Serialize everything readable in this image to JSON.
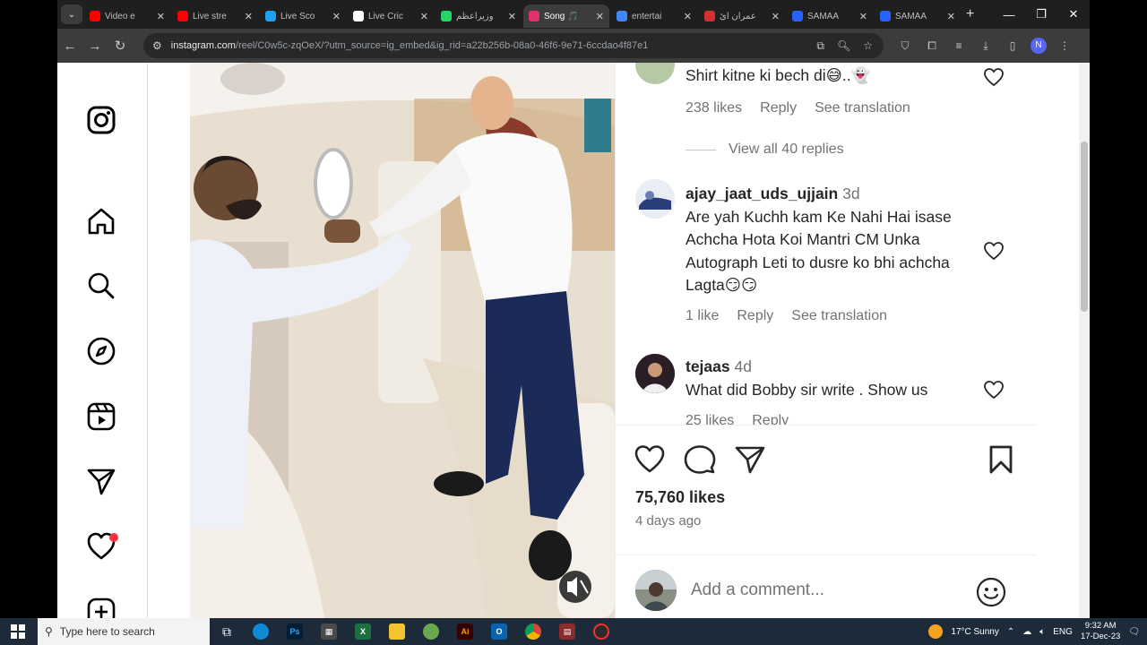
{
  "browser": {
    "tabs": [
      {
        "title": "Video e",
        "color": "#ff0000"
      },
      {
        "title": "Live stre",
        "color": "#ff0000"
      },
      {
        "title": "Live Sco",
        "color": "#1da1f2"
      },
      {
        "title": "Live Cric",
        "color": "#ffffff"
      },
      {
        "title": "وزیراعظم",
        "color": "#25d366"
      },
      {
        "title": "Song 🎵",
        "color": "#e1306c",
        "active": true
      },
      {
        "title": "entertai",
        "color": "#4285f4"
      },
      {
        "title": "عمران آئ",
        "color": "#d32f2f"
      },
      {
        "title": "SAMAA",
        "color": "#2962ff"
      },
      {
        "title": "SAMAA",
        "color": "#2962ff"
      }
    ],
    "url_host": "instagram.com",
    "url_rest": "/reel/C0w5c-zqOeX/?utm_source=ig_embed&ig_rid=a22b256b-08a0-46f6-9e71-6ccdao4f87e1",
    "profile_initial": "N"
  },
  "comments": [
    {
      "text": "Shirt kitne ki bech di😅..👻",
      "likes": "238 likes",
      "reply": "Reply",
      "translate": "See translation",
      "view_replies": "View all 40 replies"
    },
    {
      "user": "ajay_jaat_uds_ujjain",
      "time": "3d",
      "text": "Are yah Kuchh kam Ke Nahi Hai isase Achcha Hota Koi Mantri CM Unka Autograph Leti to dusre ko bhi achcha Lagta😏😏",
      "likes": "1 like",
      "reply": "Reply",
      "translate": "See translation"
    },
    {
      "user": "tejaas",
      "time": "4d",
      "text": "What did Bobby sir write . Show us",
      "likes": "25 likes",
      "reply": "Reply"
    }
  ],
  "post": {
    "likes": "75,760 likes",
    "time_ago": "4 days ago",
    "add_comment_placeholder": "Add a comment..."
  },
  "taskbar": {
    "search_placeholder": "Type here to search",
    "weather": "17°C  Sunny",
    "lang": "ENG",
    "time": "9:32 AM",
    "date": "17-Dec-23"
  },
  "colors": {
    "instagram_text": "#262626",
    "muted_text": "#737373",
    "notification": "#ff3040"
  }
}
